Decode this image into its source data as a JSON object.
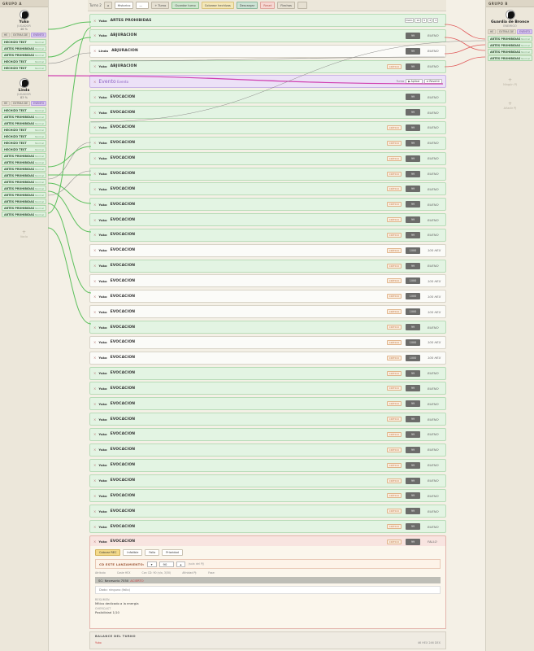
{
  "groupA": {
    "header": "GRUPO A",
    "characters": [
      {
        "name": "Yuko",
        "sub": "JUGADOR",
        "stat": "46 %",
        "tags": [
          "HE",
          "EXTRAS DE",
          "EVENTO"
        ],
        "powers": [
          {
            "name": "HECHIZO TEST",
            "stat": "Normal"
          },
          {
            "name": "ARTES PROHIBIDAS SUPE",
            "stat": "Normal"
          },
          {
            "name": "ARTES PROHIBIDAS",
            "stat": "Normal"
          },
          {
            "name": "HECHIZO TEST",
            "stat": "Normal"
          },
          {
            "name": "HECHIZO TEST",
            "stat": "Normal"
          }
        ]
      },
      {
        "name": "Linda",
        "sub": "JUGADOR",
        "stat": "83 %",
        "tags": [
          "HE",
          "EXTRAS DE",
          "EVENTO"
        ],
        "powers": [
          {
            "name": "HECHIZO TEST",
            "stat": "Normal"
          },
          {
            "name": "ARTES PROHIBIDAS SUPE",
            "stat": "Normal"
          },
          {
            "name": "ARTES PROHIBIDAS",
            "stat": "Normal"
          },
          {
            "name": "HECHIZO TEST",
            "stat": "Normal"
          },
          {
            "name": "HECHIZO TEST",
            "stat": "Normal"
          },
          {
            "name": "HECHIZO TEST",
            "stat": "Normal"
          },
          {
            "name": "HECHIZO TEST",
            "stat": "Normal"
          },
          {
            "name": "ARTES PROHIBIDAS SUPE",
            "stat": "Normal"
          },
          {
            "name": "ARTES PROHIBIDAS SUPE",
            "stat": "Normal"
          },
          {
            "name": "ARTES PROHIBIDAS SUPE",
            "stat": "Normal"
          },
          {
            "name": "ARTES PROHIBIDAS SUPE",
            "stat": "Normal"
          },
          {
            "name": "ARTES PROHIBIDAS SUPE",
            "stat": "Normal"
          },
          {
            "name": "ARTES PROHIBIDAS SUPE",
            "stat": "Normal"
          },
          {
            "name": "ARTES PROHIBIDAS SUPE",
            "stat": "Normal"
          },
          {
            "name": "ARTES PROHIBIDAS SUPE",
            "stat": "Normal"
          },
          {
            "name": "ARTES PROHIBIDAS SUPE",
            "stat": "Normal"
          },
          {
            "name": "ARTES PROHIBIDAS SUPE",
            "stat": "Normal"
          }
        ]
      }
    ],
    "empty_label": "Vacío"
  },
  "groupB": {
    "header": "GRUPO B",
    "character": {
      "name": "Guardia de Bronce",
      "sub": "ENEMIGO",
      "tags": [
        "HE",
        "EXTRAS DE",
        "EVENTO"
      ],
      "powers": [
        {
          "name": "ARTES PROHIBIDAS",
          "stat": "Normal"
        },
        {
          "name": "ARTES PROHIBIDAS",
          "stat": "Normal"
        },
        {
          "name": "ARTES PROHIBIDAS",
          "stat": "Normal"
        },
        {
          "name": "ARTES PROHIBIDAS",
          "stat": "Normal"
        }
      ]
    },
    "empty_label_1": "Ningún PJ",
    "empty_label_2": "Añadir PJ"
  },
  "toolbar": {
    "turn_label": "Turno 2",
    "history": "Historico",
    "filter": "—",
    "turn_btn": "+ Turno",
    "save_turn": "Guardar turno",
    "color_btn": "Colorear hechizos",
    "download": "Descargar",
    "reset": "Reset",
    "arrows": "Flechas"
  },
  "rows": [
    {
      "who": "Yuko",
      "act": "ARTES PROHIBIDAS",
      "kind": "green",
      "eff": "",
      "val": "",
      "res": "",
      "mini": [
        "Daño",
        "10",
        "5",
        "4",
        "3"
      ]
    },
    {
      "who": "Yuko",
      "act": "ABJURACION",
      "kind": "green",
      "eff": "",
      "val": "99",
      "res": "BUENO"
    },
    {
      "who": "Linda",
      "act": "ABJURACION",
      "kind": "white",
      "eff": "",
      "val": "99",
      "res": "BUENO"
    },
    {
      "who": "Yuko",
      "act": "ABJURACION",
      "kind": "green",
      "eff": "CRÍTICO",
      "val": "99",
      "res": "BUENO"
    },
    {
      "who": "Evento",
      "act": "Evento",
      "kind": "event",
      "eff": "",
      "val": "",
      "res": ""
    },
    {
      "who": "Yuko",
      "act": "EVOCACION",
      "kind": "green",
      "eff": "",
      "val": "99",
      "res": "BUENO"
    },
    {
      "who": "Yuko",
      "act": "EVOCACION",
      "kind": "green",
      "eff": "",
      "val": "99",
      "res": "BUENO"
    },
    {
      "who": "Yuko",
      "act": "EVOCACION",
      "kind": "green",
      "eff": "CRÍTICO",
      "val": "99",
      "res": "BUENO"
    },
    {
      "who": "Yuko",
      "act": "EVOCACION",
      "kind": "green",
      "eff": "CRÍTICO",
      "val": "99",
      "res": "BUENO"
    },
    {
      "who": "Yuko",
      "act": "EVOCACION",
      "kind": "green",
      "eff": "CRÍTICO",
      "val": "99",
      "res": "BUENO"
    },
    {
      "who": "Yuko",
      "act": "EVOCACION",
      "kind": "green",
      "eff": "CRÍTICO",
      "val": "99",
      "res": "BUENO"
    },
    {
      "who": "Yuko",
      "act": "EVOCACION",
      "kind": "green",
      "eff": "CRÍTICO",
      "val": "99",
      "res": "BUENO"
    },
    {
      "who": "Yuko",
      "act": "EVOCACION",
      "kind": "green",
      "eff": "CRÍTICO",
      "val": "99",
      "res": "BUENO"
    },
    {
      "who": "Yuko",
      "act": "EVOCACION",
      "kind": "green",
      "eff": "CRÍTICO",
      "val": "99",
      "res": "BUENO"
    },
    {
      "who": "Yuko",
      "act": "EVOCACION",
      "kind": "green",
      "eff": "CRÍTICO",
      "val": "99",
      "res": "BUENO"
    },
    {
      "who": "Yuko",
      "act": "EVOCACION",
      "kind": "white",
      "eff": "CRÍTICO",
      "val": "1000",
      "res": "100 HEX"
    },
    {
      "who": "Yuko",
      "act": "EVOCACION",
      "kind": "green",
      "eff": "CRÍTICO",
      "val": "99",
      "res": "BUENO"
    },
    {
      "who": "Yuko",
      "act": "EVOCACION",
      "kind": "white",
      "eff": "CRÍTICO",
      "val": "1000",
      "res": "100 HEX"
    },
    {
      "who": "Yuko",
      "act": "EVOCACION",
      "kind": "white",
      "eff": "CRÍTICO",
      "val": "1000",
      "res": "100 HEX"
    },
    {
      "who": "Yuko",
      "act": "EVOCACION",
      "kind": "white",
      "eff": "CRÍTICO",
      "val": "1000",
      "res": "100 HEX"
    },
    {
      "who": "Yuko",
      "act": "EVOCACION",
      "kind": "green",
      "eff": "CRÍTICO",
      "val": "99",
      "res": "BUENO"
    },
    {
      "who": "Yuko",
      "act": "EVOCACION",
      "kind": "white",
      "eff": "CRÍTICO",
      "val": "1000",
      "res": "100 HEX"
    },
    {
      "who": "Yuko",
      "act": "EVOCACION",
      "kind": "white",
      "eff": "CRÍTICO",
      "val": "1000",
      "res": "100 HEX"
    },
    {
      "who": "Yuko",
      "act": "EVOCACION",
      "kind": "green",
      "eff": "CRÍTICO",
      "val": "99",
      "res": "BUENO"
    },
    {
      "who": "Yuko",
      "act": "EVOCACION",
      "kind": "green",
      "eff": "CRÍTICO",
      "val": "99",
      "res": "BUENO"
    },
    {
      "who": "Yuko",
      "act": "EVOCACION",
      "kind": "green",
      "eff": "CRÍTICO",
      "val": "99",
      "res": "BUENO"
    },
    {
      "who": "Yuko",
      "act": "EVOCACION",
      "kind": "green",
      "eff": "CRÍTICO",
      "val": "99",
      "res": "BUENO"
    },
    {
      "who": "Yuko",
      "act": "EVOCACION",
      "kind": "green",
      "eff": "CRÍTICO",
      "val": "99",
      "res": "BUENO"
    },
    {
      "who": "Yuko",
      "act": "EVOCACION",
      "kind": "green",
      "eff": "CRÍTICO",
      "val": "99",
      "res": "BUENO"
    },
    {
      "who": "Yuko",
      "act": "EVOCACION",
      "kind": "green",
      "eff": "CRÍTICO",
      "val": "99",
      "res": "BUENO"
    },
    {
      "who": "Yuko",
      "act": "EVOCACION",
      "kind": "green",
      "eff": "CRÍTICO",
      "val": "99",
      "res": "BUENO"
    },
    {
      "who": "Yuko",
      "act": "EVOCACION",
      "kind": "green",
      "eff": "CRÍTICO",
      "val": "99",
      "res": "BUENO"
    },
    {
      "who": "Yuko",
      "act": "EVOCACION",
      "kind": "green",
      "eff": "CRÍTICO",
      "val": "99",
      "res": "BUENO"
    },
    {
      "who": "Yuko",
      "act": "EVOCACION",
      "kind": "green",
      "eff": "CRÍTICO",
      "val": "99",
      "res": "BUENO"
    },
    {
      "who": "Yuko",
      "act": "EVOCACION",
      "kind": "active",
      "eff": "CRÍTICO",
      "val": "99",
      "res": "FALLO"
    }
  ],
  "event_row": {
    "who": "Evento",
    "label": "Turno",
    "btn1": "▶ Aplicar",
    "btn2": "⇄ Revertir"
  },
  "panel": {
    "btns": [
      "Colocar REC",
      "Infalible",
      "Fallo",
      "Prioridad"
    ],
    "cd_label": "CD ESTE LANZAMIENTO:",
    "cd_value": "90",
    "cd_hint": "(sola del PJ)",
    "stats": [
      "Atributo",
      "Coste HEX",
      "Con CD: 90 (n/a, 3/30)",
      "Afinidad PJ:",
      "Fase:"
    ],
    "result_line": "SC:",
    "result_value": "Necesario 7050",
    "result_hit": "ACIERTO",
    "msg": "Dado: ninguno (fallo)",
    "resumen_l": "RESUMEN",
    "resumen_t": "Mítico dedicado a la energía",
    "overcast_l": "OVERCAST",
    "overcast_t": "Posibilidad 1/10"
  },
  "balance": {
    "header": "BALANCE DEL TURNO",
    "left": "Yuko",
    "right": "46 HEX   246 DEX"
  }
}
